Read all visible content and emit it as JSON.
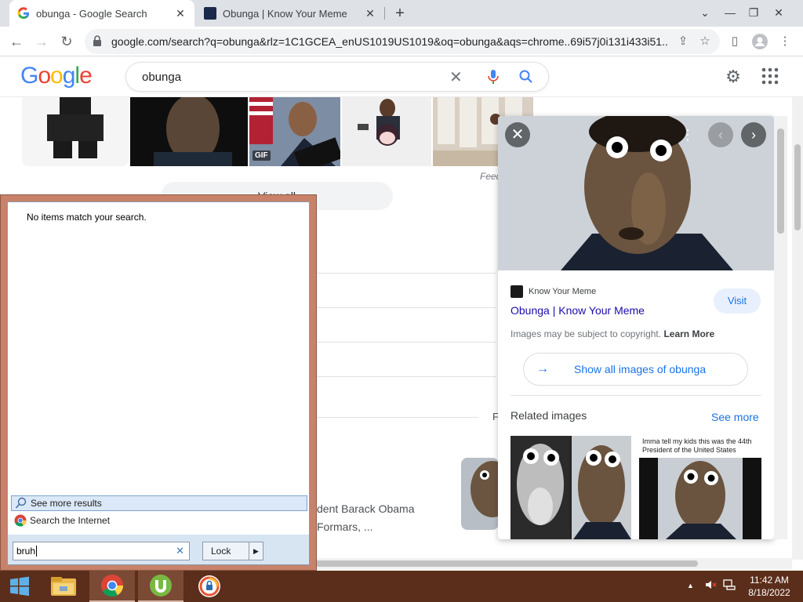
{
  "browser": {
    "tabs": [
      {
        "title": "obunga - Google Search",
        "favicon": "google-g-icon"
      },
      {
        "title": "Obunga | Know Your Meme",
        "favicon": "kym-icon"
      }
    ],
    "address": "google.com/search?q=obunga&rlz=1C1GCEA_enUS1019US1019&oq=obunga&aqs=chrome..69i57j0i131i433i51..."
  },
  "google": {
    "logo": "Google",
    "query": "obunga"
  },
  "results": {
    "feedback": "Feed",
    "view_all": "View all",
    "snippet_line1": "dent Barack Obama",
    "snippet_line2": "Formars, ...",
    "side_letter": "F",
    "gif_badge": "GIF"
  },
  "panel": {
    "source_name": "Know Your Meme",
    "title": "Obunga | Know Your Meme",
    "visit": "Visit",
    "copyright": "Images may be subject to copyright.",
    "learn_more": "Learn More",
    "show_all": "Show all images of obunga",
    "related": "Related images",
    "see_more": "See more",
    "related_caption": "Imma tell my kids this was the 44th President of the United States"
  },
  "startmenu": {
    "no_items": "No items match your search.",
    "see_more": "See more results",
    "search_internet": "Search the Internet",
    "input_value": "bruh",
    "lock": "Lock"
  },
  "taskbar": {
    "time": "11:42 AM",
    "date": "8/18/2022"
  },
  "colors": {
    "accent": "#1a73e8",
    "link": "#1a0dab",
    "startmenu_frame": "#c8826a",
    "taskbar": "#5b2e1b"
  }
}
